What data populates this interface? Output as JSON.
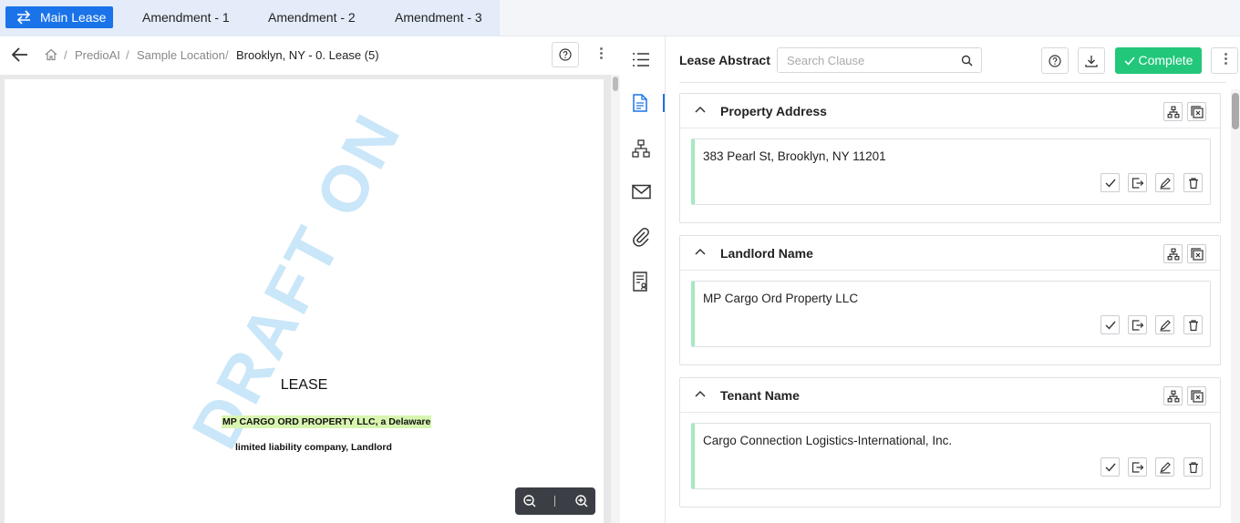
{
  "tabs": [
    {
      "label": "Main Lease",
      "active": true
    },
    {
      "label": "Amendment - 1",
      "active": false
    },
    {
      "label": "Amendment - 2",
      "active": false
    },
    {
      "label": "Amendment - 3",
      "active": false
    }
  ],
  "breadcrumb": {
    "items": [
      "PredioAI",
      "Sample Location",
      "Brooklyn, NY - 0. Lease (5)"
    ],
    "separator": "/"
  },
  "document": {
    "title": "LEASE",
    "line1": "MP CARGO ORD PROPERTY LLC, a Delaware",
    "line2": "limited liability company, Landlord",
    "highlight_color": "#d8f5b0"
  },
  "abstract": {
    "title": "Lease Abstract",
    "search_placeholder": "Search Clause",
    "complete_label": "Complete",
    "complete_icon": "check-icon"
  },
  "sections": [
    {
      "title": "Property Address",
      "value": "383 Pearl St, Brooklyn, NY 11201"
    },
    {
      "title": "Landlord Name",
      "value": "MP Cargo Ord Property LLC"
    },
    {
      "title": "Tenant Name",
      "value": "Cargo Connection Logistics-International, Inc."
    }
  ],
  "rail_icons": [
    "list-icon",
    "document-icon",
    "hierarchy-icon",
    "mail-icon",
    "attachment-icon",
    "report-icon"
  ],
  "colors": {
    "accent": "#1a73e8",
    "complete": "#22c77a",
    "card_border": "#a7e8c3",
    "tab_strip": "#e3ecf8"
  }
}
